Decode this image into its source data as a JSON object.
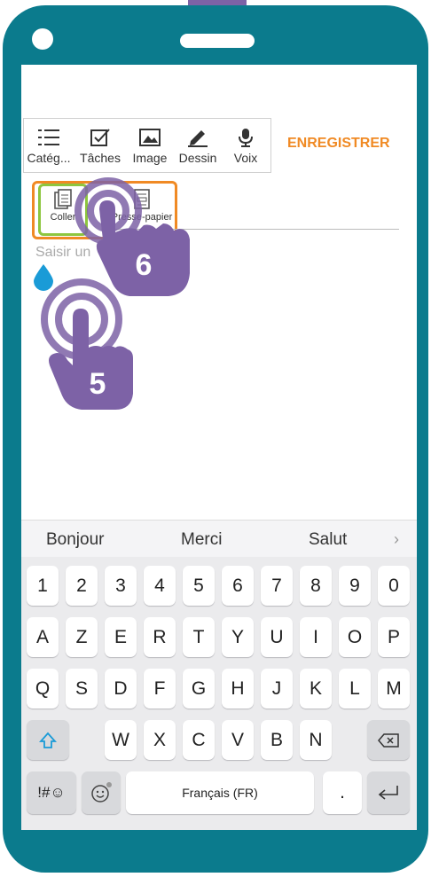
{
  "toolbar": {
    "items": [
      {
        "label": "Catég...",
        "icon": "list-icon"
      },
      {
        "label": "Tâches",
        "icon": "checkbox-icon"
      },
      {
        "label": "Image",
        "icon": "image-icon"
      },
      {
        "label": "Dessin",
        "icon": "pen-icon"
      },
      {
        "label": "Voix",
        "icon": "microphone-icon"
      }
    ],
    "save_label": "ENREGISTRER"
  },
  "paste_menu": {
    "items": [
      {
        "label": "Coller",
        "icon": "clipboard-icon"
      },
      {
        "label": "Presse-papier",
        "icon": "clipboard-board-icon"
      }
    ]
  },
  "editor": {
    "placeholder": "Saisir un"
  },
  "suggestions": [
    "Bonjour",
    "Merci",
    "Salut"
  ],
  "keyboard": {
    "row_numbers": [
      "1",
      "2",
      "3",
      "4",
      "5",
      "6",
      "7",
      "8",
      "9",
      "0"
    ],
    "row1": [
      "A",
      "Z",
      "E",
      "R",
      "T",
      "Y",
      "U",
      "I",
      "O",
      "P"
    ],
    "row2": [
      "Q",
      "S",
      "D",
      "F",
      "G",
      "H",
      "J",
      "K",
      "L",
      "M"
    ],
    "row3": [
      "W",
      "X",
      "C",
      "V",
      "B",
      "N"
    ],
    "symbols_key": "!#☺",
    "space_label": "Français (FR)",
    "period_key": "."
  },
  "steps": {
    "step_a": "5",
    "step_b": "6"
  },
  "colors": {
    "frame": "#0b7b8d",
    "accent": "#f08a24",
    "highlight": "#8dc63f",
    "hand": "#7d62a6"
  }
}
